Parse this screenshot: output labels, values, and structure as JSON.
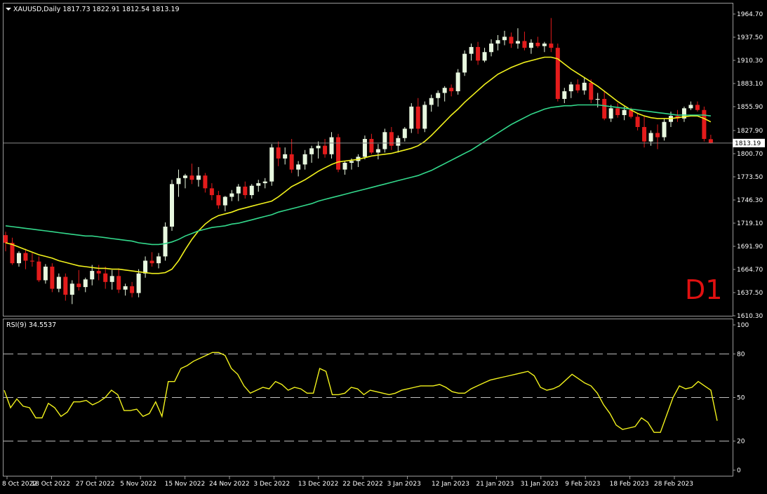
{
  "symbol_header": "XAUUSD,Daily  1817.73 1822.91 1812.54 1813.19",
  "price_panel": {
    "ylim": [
      1610.3,
      1964.7
    ],
    "tick_labels": [
      "1964.70",
      "1937.50",
      "1910.30",
      "1883.10",
      "1855.90",
      "1827.90",
      "1800.70",
      "1773.50",
      "1746.30",
      "1719.10",
      "1691.90",
      "1664.70",
      "1637.50",
      "1610.30"
    ],
    "current_price_label": "1813.19",
    "current_price": 1813.19,
    "timeframe_label": "D1"
  },
  "rsi_panel": {
    "header": "RSI(9) 34.5537",
    "ylim": [
      0,
      100
    ],
    "tick_labels": [
      "100",
      "80",
      "50",
      "20",
      "0"
    ],
    "levels": [
      80,
      50,
      20
    ]
  },
  "x_axis": {
    "tick_labels": [
      "8 Oct 2022",
      "18 Oct 2022",
      "27 Oct 2022",
      "5 Nov 2022",
      "15 Nov 2022",
      "24 Nov 2022",
      "3 Dec 2022",
      "13 Dec 2022",
      "22 Dec 2022",
      "3 Jan 2023",
      "12 Jan 2023",
      "21 Jan 2023",
      "31 Jan 2023",
      "9 Feb 2023",
      "18 Feb 2023",
      "28 Feb 2023"
    ]
  },
  "colors": {
    "background": "#000000",
    "bull_candle": "#e8f8df",
    "bear_candle": "#e31b1b",
    "wick": "#ffffff",
    "fast_ma": "#f2f21c",
    "slow_ma": "#33d98c",
    "rsi_line": "#f2f21c",
    "grid_level": "#c0c0c0",
    "axis_text": "#ffffff",
    "timeframe_label": "#e01010"
  },
  "chart_data": [
    {
      "type": "candlestick",
      "title": "XAUUSD,Daily",
      "ylim": [
        1610.3,
        1964.7
      ],
      "series": [
        {
          "name": "XAUUSD",
          "ohlc": [
            [
              1705,
              1709,
              1686,
              1696
            ],
            [
              1696,
              1702,
              1670,
              1672
            ],
            [
              1672,
              1686,
              1668,
              1684
            ],
            [
              1684,
              1689,
              1665,
              1675
            ],
            [
              1675,
              1684,
              1668,
              1674
            ],
            [
              1674,
              1680,
              1650,
              1652
            ],
            [
              1652,
              1671,
              1648,
              1668
            ],
            [
              1668,
              1672,
              1638,
              1642
            ],
            [
              1642,
              1660,
              1638,
              1656
            ],
            [
              1656,
              1660,
              1628,
              1635
            ],
            [
              1635,
              1652,
              1624,
              1648
            ],
            [
              1648,
              1664,
              1640,
              1644
            ],
            [
              1644,
              1655,
              1638,
              1653
            ],
            [
              1653,
              1670,
              1646,
              1663
            ],
            [
              1663,
              1670,
              1652,
              1660
            ],
            [
              1660,
              1668,
              1642,
              1650
            ],
            [
              1650,
              1664,
              1641,
              1657
            ],
            [
              1657,
              1666,
              1637,
              1641
            ],
            [
              1641,
              1648,
              1634,
              1645
            ],
            [
              1645,
              1650,
              1632,
              1637
            ],
            [
              1637,
              1665,
              1632,
              1660
            ],
            [
              1660,
              1680,
              1655,
              1675
            ],
            [
              1675,
              1685,
              1668,
              1672
            ],
            [
              1672,
              1684,
              1666,
              1680
            ],
            [
              1680,
              1720,
              1675,
              1715
            ],
            [
              1715,
              1770,
              1710,
              1765
            ],
            [
              1765,
              1782,
              1750,
              1772
            ],
            [
              1772,
              1777,
              1760,
              1775
            ],
            [
              1775,
              1789,
              1765,
              1770
            ],
            [
              1770,
              1785,
              1762,
              1775
            ],
            [
              1775,
              1778,
              1755,
              1760
            ],
            [
              1760,
              1766,
              1746,
              1752
            ],
            [
              1752,
              1757,
              1736,
              1740
            ],
            [
              1740,
              1751,
              1733,
              1750
            ],
            [
              1750,
              1758,
              1745,
              1754
            ],
            [
              1754,
              1765,
              1745,
              1762
            ],
            [
              1762,
              1768,
              1748,
              1752
            ],
            [
              1752,
              1765,
              1748,
              1763
            ],
            [
              1763,
              1770,
              1756,
              1766
            ],
            [
              1766,
              1772,
              1760,
              1768
            ],
            [
              1768,
              1812,
              1763,
              1808
            ],
            [
              1808,
              1815,
              1786,
              1795
            ],
            [
              1795,
              1808,
              1788,
              1800
            ],
            [
              1800,
              1818,
              1778,
              1782
            ],
            [
              1782,
              1792,
              1774,
              1788
            ],
            [
              1788,
              1805,
              1782,
              1800
            ],
            [
              1800,
              1810,
              1790,
              1807
            ],
            [
              1807,
              1815,
              1795,
              1810
            ],
            [
              1810,
              1818,
              1796,
              1800
            ],
            [
              1800,
              1826,
              1795,
              1820
            ],
            [
              1820,
              1824,
              1779,
              1782
            ],
            [
              1782,
              1792,
              1776,
              1790
            ],
            [
              1790,
              1795,
              1782,
              1792
            ],
            [
              1792,
              1800,
              1785,
              1797
            ],
            [
              1797,
              1822,
              1794,
              1818
            ],
            [
              1818,
              1824,
              1800,
              1802
            ],
            [
              1802,
              1812,
              1794,
              1806
            ],
            [
              1806,
              1830,
              1802,
              1826
            ],
            [
              1826,
              1832,
              1805,
              1810
            ],
            [
              1810,
              1822,
              1802,
              1819
            ],
            [
              1819,
              1832,
              1815,
              1830
            ],
            [
              1830,
              1860,
              1825,
              1856
            ],
            [
              1856,
              1866,
              1824,
              1830
            ],
            [
              1830,
              1862,
              1826,
              1858
            ],
            [
              1858,
              1870,
              1850,
              1866
            ],
            [
              1866,
              1875,
              1856,
              1872
            ],
            [
              1872,
              1880,
              1862,
              1878
            ],
            [
              1878,
              1882,
              1868,
              1874
            ],
            [
              1874,
              1900,
              1870,
              1896
            ],
            [
              1896,
              1922,
              1892,
              1918
            ],
            [
              1918,
              1930,
              1910,
              1926
            ],
            [
              1926,
              1932,
              1905,
              1910
            ],
            [
              1910,
              1925,
              1908,
              1920
            ],
            [
              1920,
              1935,
              1915,
              1930
            ],
            [
              1930,
              1940,
              1922,
              1934
            ],
            [
              1934,
              1945,
              1928,
              1938
            ],
            [
              1938,
              1943,
              1925,
              1930
            ],
            [
              1930,
              1948,
              1924,
              1933
            ],
            [
              1933,
              1944,
              1922,
              1925
            ],
            [
              1925,
              1935,
              1918,
              1931
            ],
            [
              1931,
              1938,
              1925,
              1927
            ],
            [
              1927,
              1932,
              1920,
              1930
            ],
            [
              1930,
              1960,
              1920,
              1925
            ],
            [
              1925,
              1930,
              1862,
              1865
            ],
            [
              1865,
              1878,
              1860,
              1874
            ],
            [
              1874,
              1885,
              1866,
              1882
            ],
            [
              1882,
              1888,
              1872,
              1875
            ],
            [
              1875,
              1890,
              1870,
              1884
            ],
            [
              1884,
              1888,
              1860,
              1864
            ],
            [
              1864,
              1872,
              1855,
              1865
            ],
            [
              1865,
              1874,
              1840,
              1842
            ],
            [
              1842,
              1858,
              1838,
              1854
            ],
            [
              1854,
              1860,
              1843,
              1846
            ],
            [
              1846,
              1856,
              1840,
              1852
            ],
            [
              1852,
              1855,
              1842,
              1844
            ],
            [
              1844,
              1848,
              1828,
              1832
            ],
            [
              1832,
              1845,
              1808,
              1815
            ],
            [
              1815,
              1828,
              1810,
              1825
            ],
            [
              1825,
              1835,
              1806,
              1820
            ],
            [
              1820,
              1842,
              1816,
              1838
            ],
            [
              1838,
              1850,
              1832,
              1845
            ],
            [
              1845,
              1852,
              1838,
              1842
            ],
            [
              1842,
              1856,
              1838,
              1854
            ],
            [
              1854,
              1862,
              1852,
              1858
            ],
            [
              1858,
              1862,
              1850,
              1852
            ],
            [
              1852,
              1856,
              1815,
              1818
            ],
            [
              1817.73,
              1822.91,
              1812.54,
              1813.19
            ]
          ]
        },
        {
          "name": "MA fast",
          "values": [
            1696,
            1694,
            1691,
            1688,
            1685,
            1682,
            1680,
            1678,
            1675,
            1673,
            1671,
            1669,
            1668,
            1667,
            1666,
            1666,
            1665,
            1665,
            1664,
            1663,
            1662,
            1661,
            1660,
            1660,
            1661,
            1665,
            1675,
            1688,
            1700,
            1710,
            1718,
            1724,
            1728,
            1730,
            1732,
            1735,
            1737,
            1739,
            1741,
            1743,
            1745,
            1750,
            1756,
            1762,
            1766,
            1770,
            1775,
            1780,
            1784,
            1788,
            1791,
            1792,
            1793,
            1794,
            1796,
            1798,
            1799,
            1800,
            1801,
            1803,
            1805,
            1807,
            1810,
            1815,
            1822,
            1830,
            1838,
            1846,
            1853,
            1861,
            1868,
            1875,
            1882,
            1888,
            1894,
            1898,
            1902,
            1905,
            1908,
            1910,
            1912,
            1914,
            1914,
            1912,
            1906,
            1900,
            1895,
            1890,
            1885,
            1880,
            1874,
            1868,
            1862,
            1857,
            1852,
            1848,
            1845,
            1843,
            1842,
            1842,
            1842,
            1843,
            1844,
            1845,
            1845,
            1842,
            1838
          ]
        },
        {
          "name": "MA slow",
          "values": [
            1716,
            1715,
            1714,
            1713,
            1712,
            1711,
            1710,
            1709,
            1708,
            1707,
            1706,
            1705,
            1704,
            1704,
            1703,
            1702,
            1701,
            1700,
            1699,
            1698,
            1696,
            1695,
            1694,
            1694,
            1695,
            1697,
            1700,
            1704,
            1707,
            1710,
            1712,
            1714,
            1715,
            1716,
            1718,
            1719,
            1721,
            1723,
            1725,
            1727,
            1729,
            1732,
            1734,
            1736,
            1738,
            1740,
            1742,
            1745,
            1747,
            1749,
            1751,
            1753,
            1755,
            1757,
            1759,
            1761,
            1763,
            1765,
            1767,
            1769,
            1771,
            1773,
            1775,
            1778,
            1781,
            1785,
            1789,
            1793,
            1797,
            1801,
            1805,
            1810,
            1815,
            1820,
            1825,
            1830,
            1835,
            1839,
            1843,
            1847,
            1850,
            1853,
            1855,
            1856,
            1857,
            1857,
            1858,
            1858,
            1858,
            1858,
            1857,
            1856,
            1855,
            1854,
            1853,
            1852,
            1851,
            1850,
            1849,
            1848,
            1847,
            1846,
            1846,
            1846,
            1846,
            1846,
            1845
          ]
        }
      ]
    },
    {
      "type": "line",
      "title": "RSI(9) 34.5537",
      "ylim": [
        0,
        100
      ],
      "series": [
        {
          "name": "RSI(9)",
          "values": [
            55,
            43,
            49,
            44,
            43,
            36,
            36,
            46,
            43,
            37,
            40,
            47,
            47,
            48,
            45,
            47,
            50,
            55,
            52,
            41,
            41,
            42,
            37,
            39,
            47,
            37,
            61,
            61,
            70,
            72,
            75,
            77,
            79,
            81,
            81,
            79,
            70,
            66,
            58,
            53,
            55,
            57,
            56,
            61,
            59,
            55,
            57,
            56,
            53,
            53,
            70,
            68,
            52,
            52,
            53,
            57,
            56,
            52,
            55,
            54,
            53,
            52,
            53,
            55,
            56,
            57,
            58,
            58,
            58,
            59,
            57,
            54,
            53,
            53,
            56,
            58,
            60,
            62,
            63,
            64,
            65,
            66,
            67,
            68,
            65,
            57,
            55,
            56,
            58,
            62,
            66,
            63,
            60,
            58,
            53,
            45,
            39,
            31,
            28,
            29,
            30,
            36,
            33,
            26,
            26,
            38,
            50,
            58,
            56,
            57,
            61,
            58,
            55,
            34
          ]
        }
      ]
    }
  ]
}
